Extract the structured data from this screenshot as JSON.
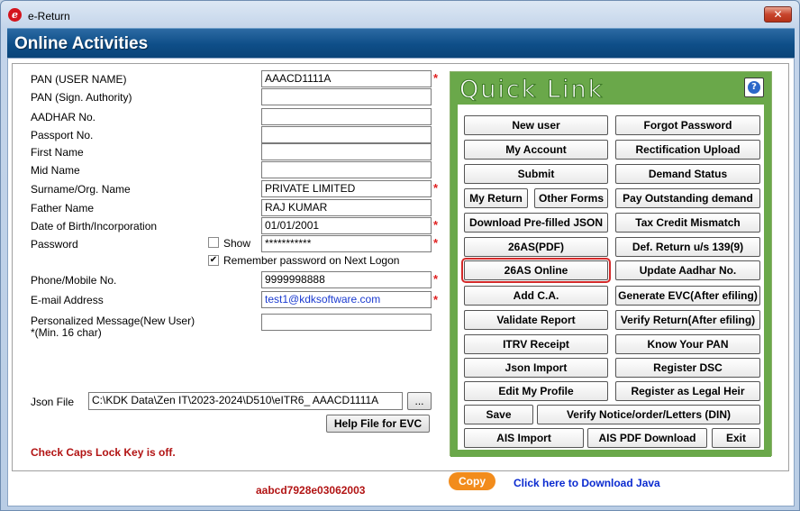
{
  "window": {
    "title": "e-Return",
    "close_label": "✕"
  },
  "header": {
    "title": "Online Activities"
  },
  "form": {
    "pan": {
      "label": "PAN (USER NAME)",
      "value": "AAACD1111A"
    },
    "pan_sign": {
      "label": "PAN (Sign. Authority)",
      "value": ""
    },
    "aadhar": {
      "label": "AADHAR No.",
      "value": ""
    },
    "passport": {
      "label": "Passport No.",
      "value": ""
    },
    "first_name": {
      "label": "First Name",
      "value": ""
    },
    "mid_name": {
      "label": "Mid Name",
      "value": ""
    },
    "surname": {
      "label": "Surname/Org. Name",
      "value": "PRIVATE LIMITED"
    },
    "father_name": {
      "label": "Father Name",
      "value": "RAJ KUMAR"
    },
    "dob": {
      "label": "Date of Birth/Incorporation",
      "value": "01/01/2001"
    },
    "password": {
      "label": "Password",
      "value": "***********",
      "show_label": "Show",
      "show_checked": false
    },
    "remember": {
      "label": "Remember password on Next Logon",
      "checked": true
    },
    "phone": {
      "label": "Phone/Mobile No.",
      "value": "9999998888"
    },
    "email": {
      "label": "E-mail Address",
      "value": "test1@kdksoftware.com"
    },
    "message": {
      "label_line1": "Personalized Message(New User)",
      "label_line2": "*(Min. 16 char)",
      "value": ""
    },
    "json_file": {
      "label": "Json File",
      "value": "C:\\KDK Data\\Zen IT\\2023-2024\\D510\\eITR6_ AAACD1111A",
      "browse_label": "..."
    },
    "required_mark": "*"
  },
  "help_evc_label": "Help File for EVC",
  "caps_message": "Check Caps Lock Key is off.",
  "serial_code": "aabcd7928e03062003",
  "copy_label": "Copy",
  "java_link": "Click here to Download Java",
  "quick_link": {
    "title": "Quick Link",
    "help_label": "?",
    "buttons": {
      "new_user": "New user",
      "forgot_password": "Forgot Password",
      "my_account": "My Account",
      "rectification_upload": "Rectification Upload",
      "submit": "Submit",
      "demand_status": "Demand Status",
      "my_return": "My Return",
      "other_forms": "Other Forms",
      "pay_outstanding": "Pay Outstanding demand",
      "download_prefilled": "Download Pre-filled JSON",
      "tax_credit_mismatch": "Tax Credit Mismatch",
      "as26_pdf": "26AS(PDF)",
      "def_return": "Def. Return u/s 139(9)",
      "as26_online": "26AS Online",
      "update_aadhar": "Update Aadhar No.",
      "add_ca": "Add C.A.",
      "generate_evc": "Generate EVC(After efiling)",
      "validate_report": "Validate Report",
      "verify_return": "Verify Return(After efiling)",
      "itrv_receipt": "ITRV Receipt",
      "know_pan": "Know Your PAN",
      "json_import": "Json Import",
      "register_dsc": "Register DSC",
      "edit_profile": "Edit My Profile",
      "register_legal_heir": "Register as Legal Heir",
      "save": "Save",
      "verify_notice": "Verify Notice/order/Letters (DIN)",
      "ais_import": "AIS Import",
      "ais_pdf": "AIS PDF Download",
      "exit": "Exit"
    }
  }
}
